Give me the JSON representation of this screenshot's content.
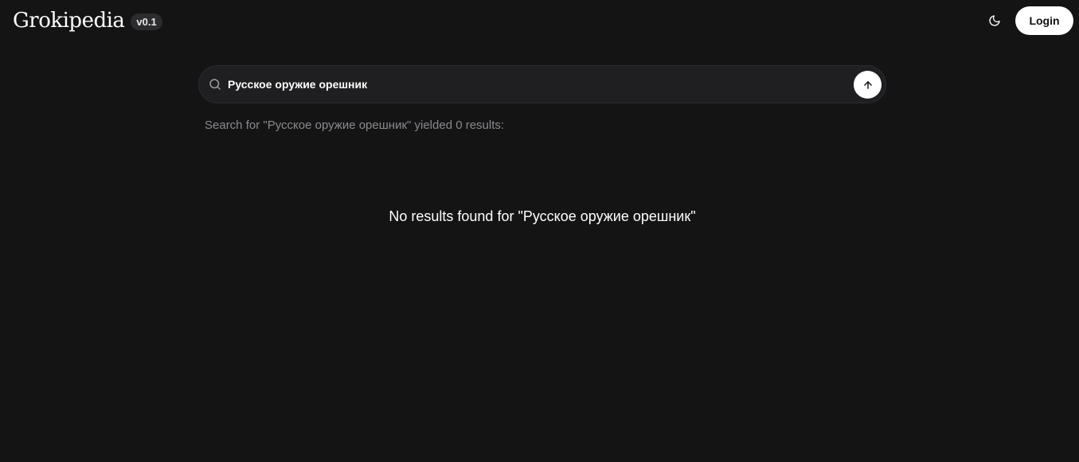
{
  "header": {
    "logo": "Grokipedia",
    "version": "v0.1",
    "theme_icon": "moon-icon",
    "login_label": "Login"
  },
  "search": {
    "value": "Русское оружие орешник",
    "icon": "search-icon",
    "submit_icon": "arrow-up-icon"
  },
  "results": {
    "summary": "Search for \"Русское оружие орешник\" yielded 0 results:",
    "empty_message": "No results found for \"Русское оружие орешник\""
  },
  "colors": {
    "background": "#141415",
    "search_background": "#1f1f21",
    "muted_text": "#8a8a8e",
    "button_background": "#ffffff"
  }
}
